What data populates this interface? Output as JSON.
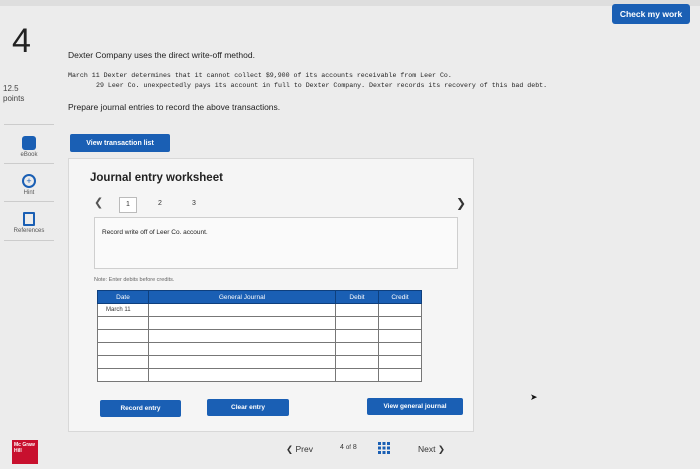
{
  "header": {
    "check_label": "Check my work"
  },
  "question": {
    "number": "4",
    "points_value": "12.5",
    "points_label": "points",
    "intro": "Dexter Company uses the direct write-off method.",
    "line1": "March 11 Dexter determines that it cannot collect $9,900 of its accounts receivable from Leer Co.",
    "line2": "29 Leer Co. unexpectedly pays its account in full to Dexter Company. Dexter records its recovery of this bad debt.",
    "prepare": "Prepare journal entries to record the above transactions."
  },
  "sidebar": {
    "ebook": "eBook",
    "hint": "Hint",
    "references": "References"
  },
  "worksheet": {
    "view_list_label": "View transaction list",
    "title": "Journal entry worksheet",
    "pages": [
      "1",
      "2",
      "3"
    ],
    "instruction": "Record write off of Leer Co. account.",
    "note": "Note: Enter debits before credits.",
    "columns": {
      "date": "Date",
      "general_journal": "General Journal",
      "debit": "Debit",
      "credit": "Credit"
    },
    "rows": [
      {
        "date": "March 11",
        "account": "",
        "debit": "",
        "credit": ""
      },
      {
        "date": "",
        "account": "",
        "debit": "",
        "credit": ""
      },
      {
        "date": "",
        "account": "",
        "debit": "",
        "credit": ""
      },
      {
        "date": "",
        "account": "",
        "debit": "",
        "credit": ""
      },
      {
        "date": "",
        "account": "",
        "debit": "",
        "credit": ""
      },
      {
        "date": "",
        "account": "",
        "debit": "",
        "credit": ""
      }
    ],
    "record_label": "Record entry",
    "clear_label": "Clear entry",
    "view_journal_label": "View general journal"
  },
  "footer": {
    "logo_text": "Mc Graw Hill",
    "prev_label": "Prev",
    "page_current": "4",
    "page_of": "of",
    "page_total": "8",
    "next_label": "Next"
  },
  "colors": {
    "accent": "#1a5fb4",
    "logo": "#c8102e"
  }
}
